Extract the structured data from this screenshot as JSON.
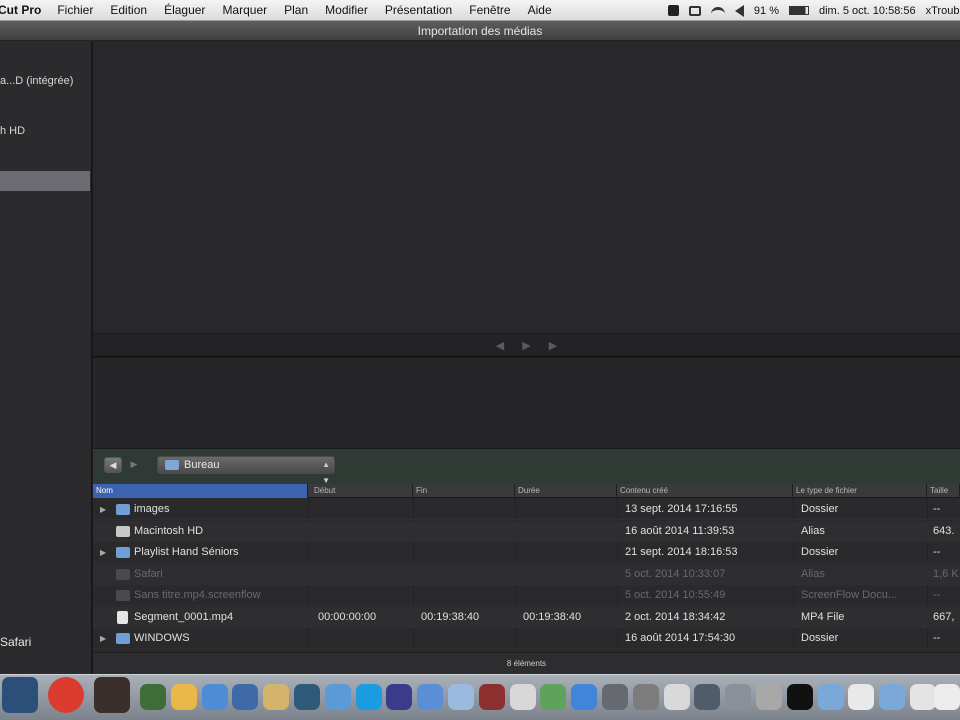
{
  "menubar": {
    "app_name": "Cut Pro",
    "items": [
      "Fichier",
      "Edition",
      "Élaguer",
      "Marquer",
      "Plan",
      "Modifier",
      "Présentation",
      "Fenêtre",
      "Aide"
    ],
    "battery": "91 %",
    "datetime": "dim. 5 oct.  10:58:56",
    "user": "xTrouble"
  },
  "window": {
    "title": "Importation des médias"
  },
  "sidebar": {
    "items": [
      {
        "label": "a...D (intégrée)"
      },
      {
        "label": "h HD"
      },
      {
        "label": ""
      },
      {
        "label": "Safari"
      }
    ]
  },
  "transport": {
    "prev": "◀",
    "play": "▶",
    "next": "▶"
  },
  "browser": {
    "back": "◀",
    "forward": "▶",
    "location": "Bureau"
  },
  "table": {
    "columns": [
      "Nom",
      "Début",
      "Fin",
      "Durée",
      "Contenu créé",
      "Le type de fichier",
      "Taille"
    ],
    "rows": [
      {
        "name": "images",
        "start": "",
        "end": "",
        "duration": "",
        "created": "13 sept. 2014 17:16:55",
        "type": "Dossier",
        "size": "--",
        "kind": "folder",
        "expandable": true,
        "dimmed": false
      },
      {
        "name": "Macintosh HD",
        "start": "",
        "end": "",
        "duration": "",
        "created": "16 août 2014 11:39:53",
        "type": "Alias",
        "size": "643.",
        "kind": "drive",
        "expandable": false,
        "dimmed": false
      },
      {
        "name": "Playlist Hand Séniors",
        "start": "",
        "end": "",
        "duration": "",
        "created": "21 sept. 2014 18:16:53",
        "type": "Dossier",
        "size": "--",
        "kind": "folder",
        "expandable": true,
        "dimmed": false
      },
      {
        "name": "Safari",
        "start": "",
        "end": "",
        "duration": "",
        "created": "5 oct. 2014 10:33:07",
        "type": "Alias",
        "size": "1,6 K",
        "kind": "ghost",
        "expandable": false,
        "dimmed": true
      },
      {
        "name": "Sans titre.mp4.screenflow",
        "start": "",
        "end": "",
        "duration": "",
        "created": "5 oct. 2014 10:55:49",
        "type": "ScreenFlow Docu...",
        "size": "--",
        "kind": "ghost",
        "expandable": false,
        "dimmed": true
      },
      {
        "name": "Segment_0001.mp4",
        "start": "00:00:00:00",
        "end": "00:19:38:40",
        "duration": "00:19:38:40",
        "created": "2 oct. 2014 18:34:42",
        "type": "MP4 File",
        "size": "667,",
        "kind": "file",
        "expandable": false,
        "dimmed": false
      },
      {
        "name": "WINDOWS",
        "start": "",
        "end": "",
        "duration": "",
        "created": "16 août 2014 17:54:30",
        "type": "Dossier",
        "size": "--",
        "kind": "folder",
        "expandable": true,
        "dimmed": false
      }
    ]
  },
  "status": {
    "count": "8 éléments"
  },
  "dock": {
    "icons": [
      "finder-icon",
      "chrome-icon",
      "photo-icon",
      "iphoto-icon",
      "app-icon",
      "safari-icon",
      "preview-icon",
      "notes-icon",
      "time-machine-icon",
      "mail-icon",
      "skype-icon",
      "quicktime-icon",
      "mail-app-icon",
      "itunes-icon",
      "photo-booth-icon",
      "calendar-icon",
      "maps-icon",
      "app-store-icon",
      "system-icon",
      "disk-icon",
      "iphone-backup-icon",
      "screen-icon",
      "pref-icon",
      "onyx-icon",
      "black-icon",
      "folder-icon",
      "document-icon",
      "folder2-icon",
      "mail2-icon",
      "window-icon",
      "window2-icon"
    ],
    "colors": [
      "#2c4f7a",
      "#dc3b2f",
      "#3a2f2a",
      "#3f6d3a",
      "#eab84a",
      "#4f8cd6",
      "#3f6aa8",
      "#d4b36a",
      "#2e5a79",
      "#5b9ad6",
      "#1b9be0",
      "#3b3b8c",
      "#5a8ed6",
      "#9cb9e0",
      "#8c2f2f",
      "#d8d8d8",
      "#5da35b",
      "#3f85d9",
      "#666a70",
      "#7c7c7c",
      "#d9d9d9",
      "#505c6a",
      "#8a8f98",
      "#a8a8a8",
      "#111111",
      "#7aa8d8",
      "#e9e9e9",
      "#7aa8d8",
      "#e4e4e4",
      "#e9e9e9",
      "#ececec"
    ]
  }
}
